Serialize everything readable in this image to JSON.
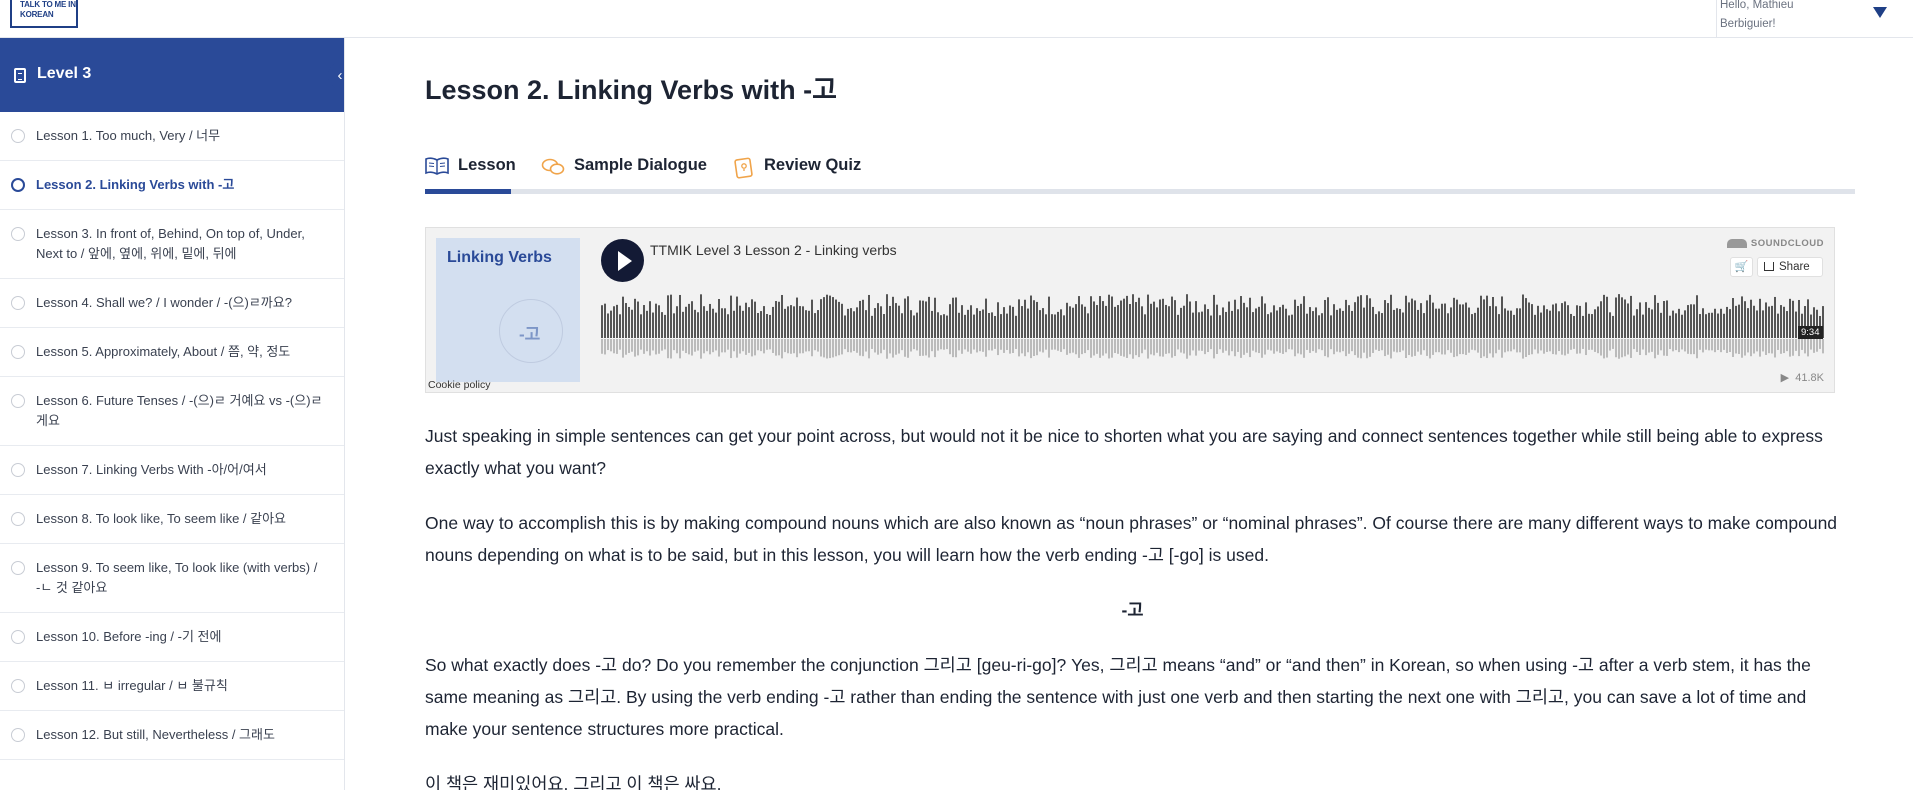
{
  "topbar": {
    "logo_text": "TALK TO ME IN KOREAN",
    "greeting": "Hello, Mathieu Berbiguier!"
  },
  "sidebar": {
    "title": "Level 3",
    "items": [
      {
        "label": "Lesson 1. Too much, Very / 너무"
      },
      {
        "label": "Lesson 2. Linking Verbs with -고"
      },
      {
        "label": "Lesson 3. In front of, Behind, On top of, Under, Next to / 앞에, 옆에, 위에, 밑에, 뒤에"
      },
      {
        "label": "Lesson 4. Shall we? / I wonder / -(으)ㄹ까요?"
      },
      {
        "label": "Lesson 5. Approximately, About / 쯤, 약, 정도"
      },
      {
        "label": "Lesson 6. Future Tenses / -(으)ㄹ 거예요 vs -(으)ㄹ게요"
      },
      {
        "label": "Lesson 7. Linking Verbs With -아/어/여서"
      },
      {
        "label": "Lesson 8. To look like, To seem like / 같아요"
      },
      {
        "label": "Lesson 9. To seem like, To look like (with verbs) / -ㄴ 것 같아요"
      },
      {
        "label": "Lesson 10. Before -ing / -기 전에"
      },
      {
        "label": "Lesson 11. ㅂ irregular / ㅂ 불규칙"
      },
      {
        "label": "Lesson 12. But still, Nevertheless / 그래도"
      }
    ],
    "active_index": 1
  },
  "main": {
    "title": "Lesson 2. Linking Verbs with -고",
    "tabs": [
      {
        "label": "Lesson",
        "icon": "book-open-icon"
      },
      {
        "label": "Sample Dialogue",
        "icon": "speech-bubbles-icon"
      },
      {
        "label": "Review Quiz",
        "icon": "quiz-card-icon"
      }
    ],
    "active_tab": 0
  },
  "player": {
    "artwork_title": "Linking Verbs",
    "artwork_text": "-고",
    "track_title": "TTMIK Level 3 Lesson 2 - Linking verbs",
    "brand": "SOUNDCLOUD",
    "share_label": "Share",
    "duration": "9:34",
    "plays": "41.8K",
    "cookie_policy": "Cookie policy"
  },
  "content": {
    "paragraphs": [
      "Just speaking in simple sentences can get your point across, but would not it be nice to shorten what you are saying and connect sentences together while still being able to express exactly what you want?",
      "One way to accomplish this is by making compound nouns which are also known as “noun phrases” or “nominal phrases”. Of course there are many different ways to make compound nouns depending on what is to be said, but in this lesson, you will learn how the verb ending -고 [-go] is used.",
      "-고",
      "So what exactly does -고 do? Do you remember the conjunction 그리고 [geu-ri-go]? Yes, 그리고 means “and” or “and then” in Korean, so when using -고 after a verb stem, it has the same meaning as 그리고. By using the verb ending -고 rather than ending the sentence with just one verb and then starting the next one with 그리고, you can save a lot of time and make your sentence structures more practical.",
      "이 책은 재미있어요. 그리고 이 책은 싸요."
    ]
  },
  "colors": {
    "brand_blue": "#2a4a98",
    "tab_icon_orange": "#f0a44a",
    "play_button": "#131a35"
  }
}
